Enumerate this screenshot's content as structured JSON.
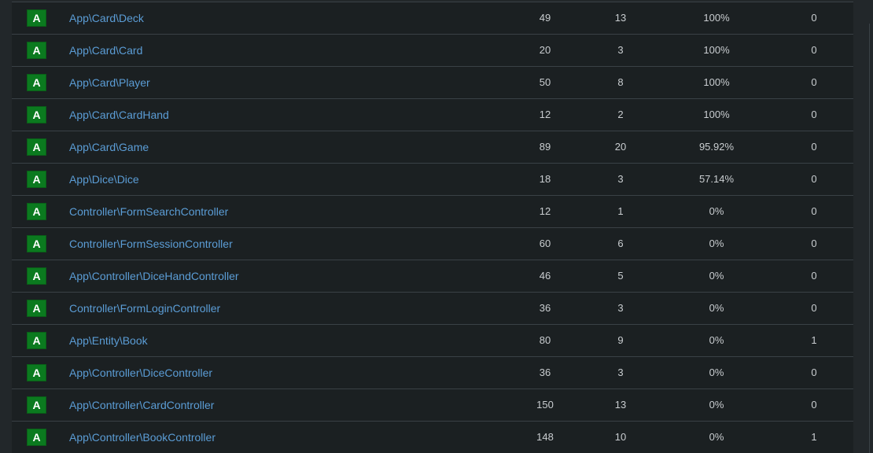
{
  "colors": {
    "background": "#22272a",
    "table_bg": "#1b2022",
    "grade_a": "#0b7a1f",
    "link": "#5b9dd6",
    "text": "#c9cdd0"
  },
  "rows": [
    {
      "grade": "A",
      "name": "App\\Card\\Deck",
      "loc": "49",
      "methods": "13",
      "coverage": "100%",
      "violations": "0"
    },
    {
      "grade": "A",
      "name": "App\\Card\\Card",
      "loc": "20",
      "methods": "3",
      "coverage": "100%",
      "violations": "0"
    },
    {
      "grade": "A",
      "name": "App\\Card\\Player",
      "loc": "50",
      "methods": "8",
      "coverage": "100%",
      "violations": "0"
    },
    {
      "grade": "A",
      "name": "App\\Card\\CardHand",
      "loc": "12",
      "methods": "2",
      "coverage": "100%",
      "violations": "0"
    },
    {
      "grade": "A",
      "name": "App\\Card\\Game",
      "loc": "89",
      "methods": "20",
      "coverage": "95.92%",
      "violations": "0"
    },
    {
      "grade": "A",
      "name": "App\\Dice\\Dice",
      "loc": "18",
      "methods": "3",
      "coverage": "57.14%",
      "violations": "0"
    },
    {
      "grade": "A",
      "name": "Controller\\FormSearchController",
      "loc": "12",
      "methods": "1",
      "coverage": "0%",
      "violations": "0"
    },
    {
      "grade": "A",
      "name": "Controller\\FormSessionController",
      "loc": "60",
      "methods": "6",
      "coverage": "0%",
      "violations": "0"
    },
    {
      "grade": "A",
      "name": "App\\Controller\\DiceHandController",
      "loc": "46",
      "methods": "5",
      "coverage": "0%",
      "violations": "0"
    },
    {
      "grade": "A",
      "name": "Controller\\FormLoginController",
      "loc": "36",
      "methods": "3",
      "coverage": "0%",
      "violations": "0"
    },
    {
      "grade": "A",
      "name": "App\\Entity\\Book",
      "loc": "80",
      "methods": "9",
      "coverage": "0%",
      "violations": "1"
    },
    {
      "grade": "A",
      "name": "App\\Controller\\DiceController",
      "loc": "36",
      "methods": "3",
      "coverage": "0%",
      "violations": "0"
    },
    {
      "grade": "A",
      "name": "App\\Controller\\CardController",
      "loc": "150",
      "methods": "13",
      "coverage": "0%",
      "violations": "0"
    },
    {
      "grade": "A",
      "name": "App\\Controller\\BookController",
      "loc": "148",
      "methods": "10",
      "coverage": "0%",
      "violations": "1"
    }
  ]
}
